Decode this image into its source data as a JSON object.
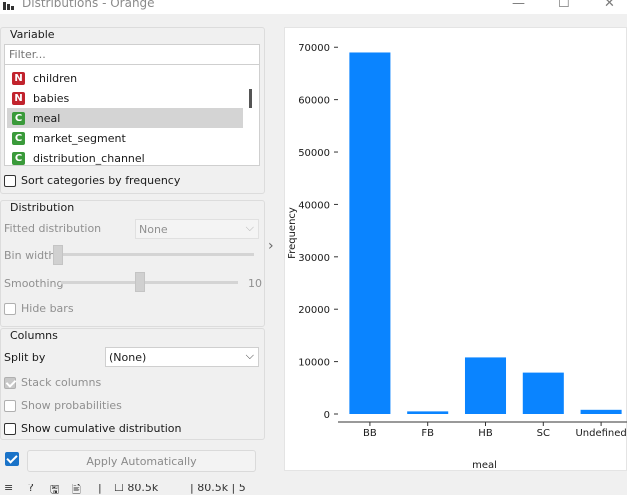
{
  "window": {
    "title": "Distributions - Orange",
    "icons": [
      "app-icon",
      "minimize-icon",
      "maximize-icon",
      "close-icon"
    ]
  },
  "variable_box": {
    "title": "Variable",
    "filter_placeholder": "Filter...",
    "items": [
      {
        "type": "N",
        "name": "children"
      },
      {
        "type": "N",
        "name": "babies"
      },
      {
        "type": "C",
        "name": "meal"
      },
      {
        "type": "C",
        "name": "market_segment"
      },
      {
        "type": "C",
        "name": "distribution_channel"
      }
    ],
    "selected": "meal",
    "sort_label": "Sort categories by frequency"
  },
  "distribution_box": {
    "title": "Distribution",
    "fitted_label": "Fitted distribution",
    "fitted_value": "None",
    "bin_width_label": "Bin width",
    "smoothing_label": "Smoothing",
    "smoothing_value": "10",
    "hide_bars_label": "Hide bars"
  },
  "columns_box": {
    "title": "Columns",
    "split_label": "Split by",
    "split_value": "(None)",
    "stack_label": "Stack columns",
    "stack_checked": true,
    "probabilities_label": "Show probabilities",
    "cumulative_label": "Show cumulative distribution"
  },
  "apply": {
    "label": "Apply Automatically",
    "checked": true
  },
  "expander_glyph": "›",
  "statusbar": {
    "items": [
      "≡",
      "?",
      "🖫",
      "🖹",
      "|",
      "☐ 80.5k",
      "| 80.5k | 5"
    ]
  },
  "colors": {
    "bar": "#0a84ff",
    "selected_row": "#d4d4d4",
    "numeric_badge": "#c1232d",
    "categorical_badge": "#3a9a3a",
    "apply_check": "#1a73c8"
  },
  "chart_data": {
    "type": "bar",
    "categories": [
      "BB",
      "FB",
      "HB",
      "SC",
      "Undefined"
    ],
    "values": [
      69000,
      500,
      10800,
      7900,
      800
    ],
    "xlabel": "meal",
    "ylabel": "Frequency",
    "yticks": [
      0,
      10000,
      20000,
      30000,
      40000,
      50000,
      60000,
      70000
    ],
    "ylim": [
      0,
      71000
    ],
    "grid": false
  }
}
